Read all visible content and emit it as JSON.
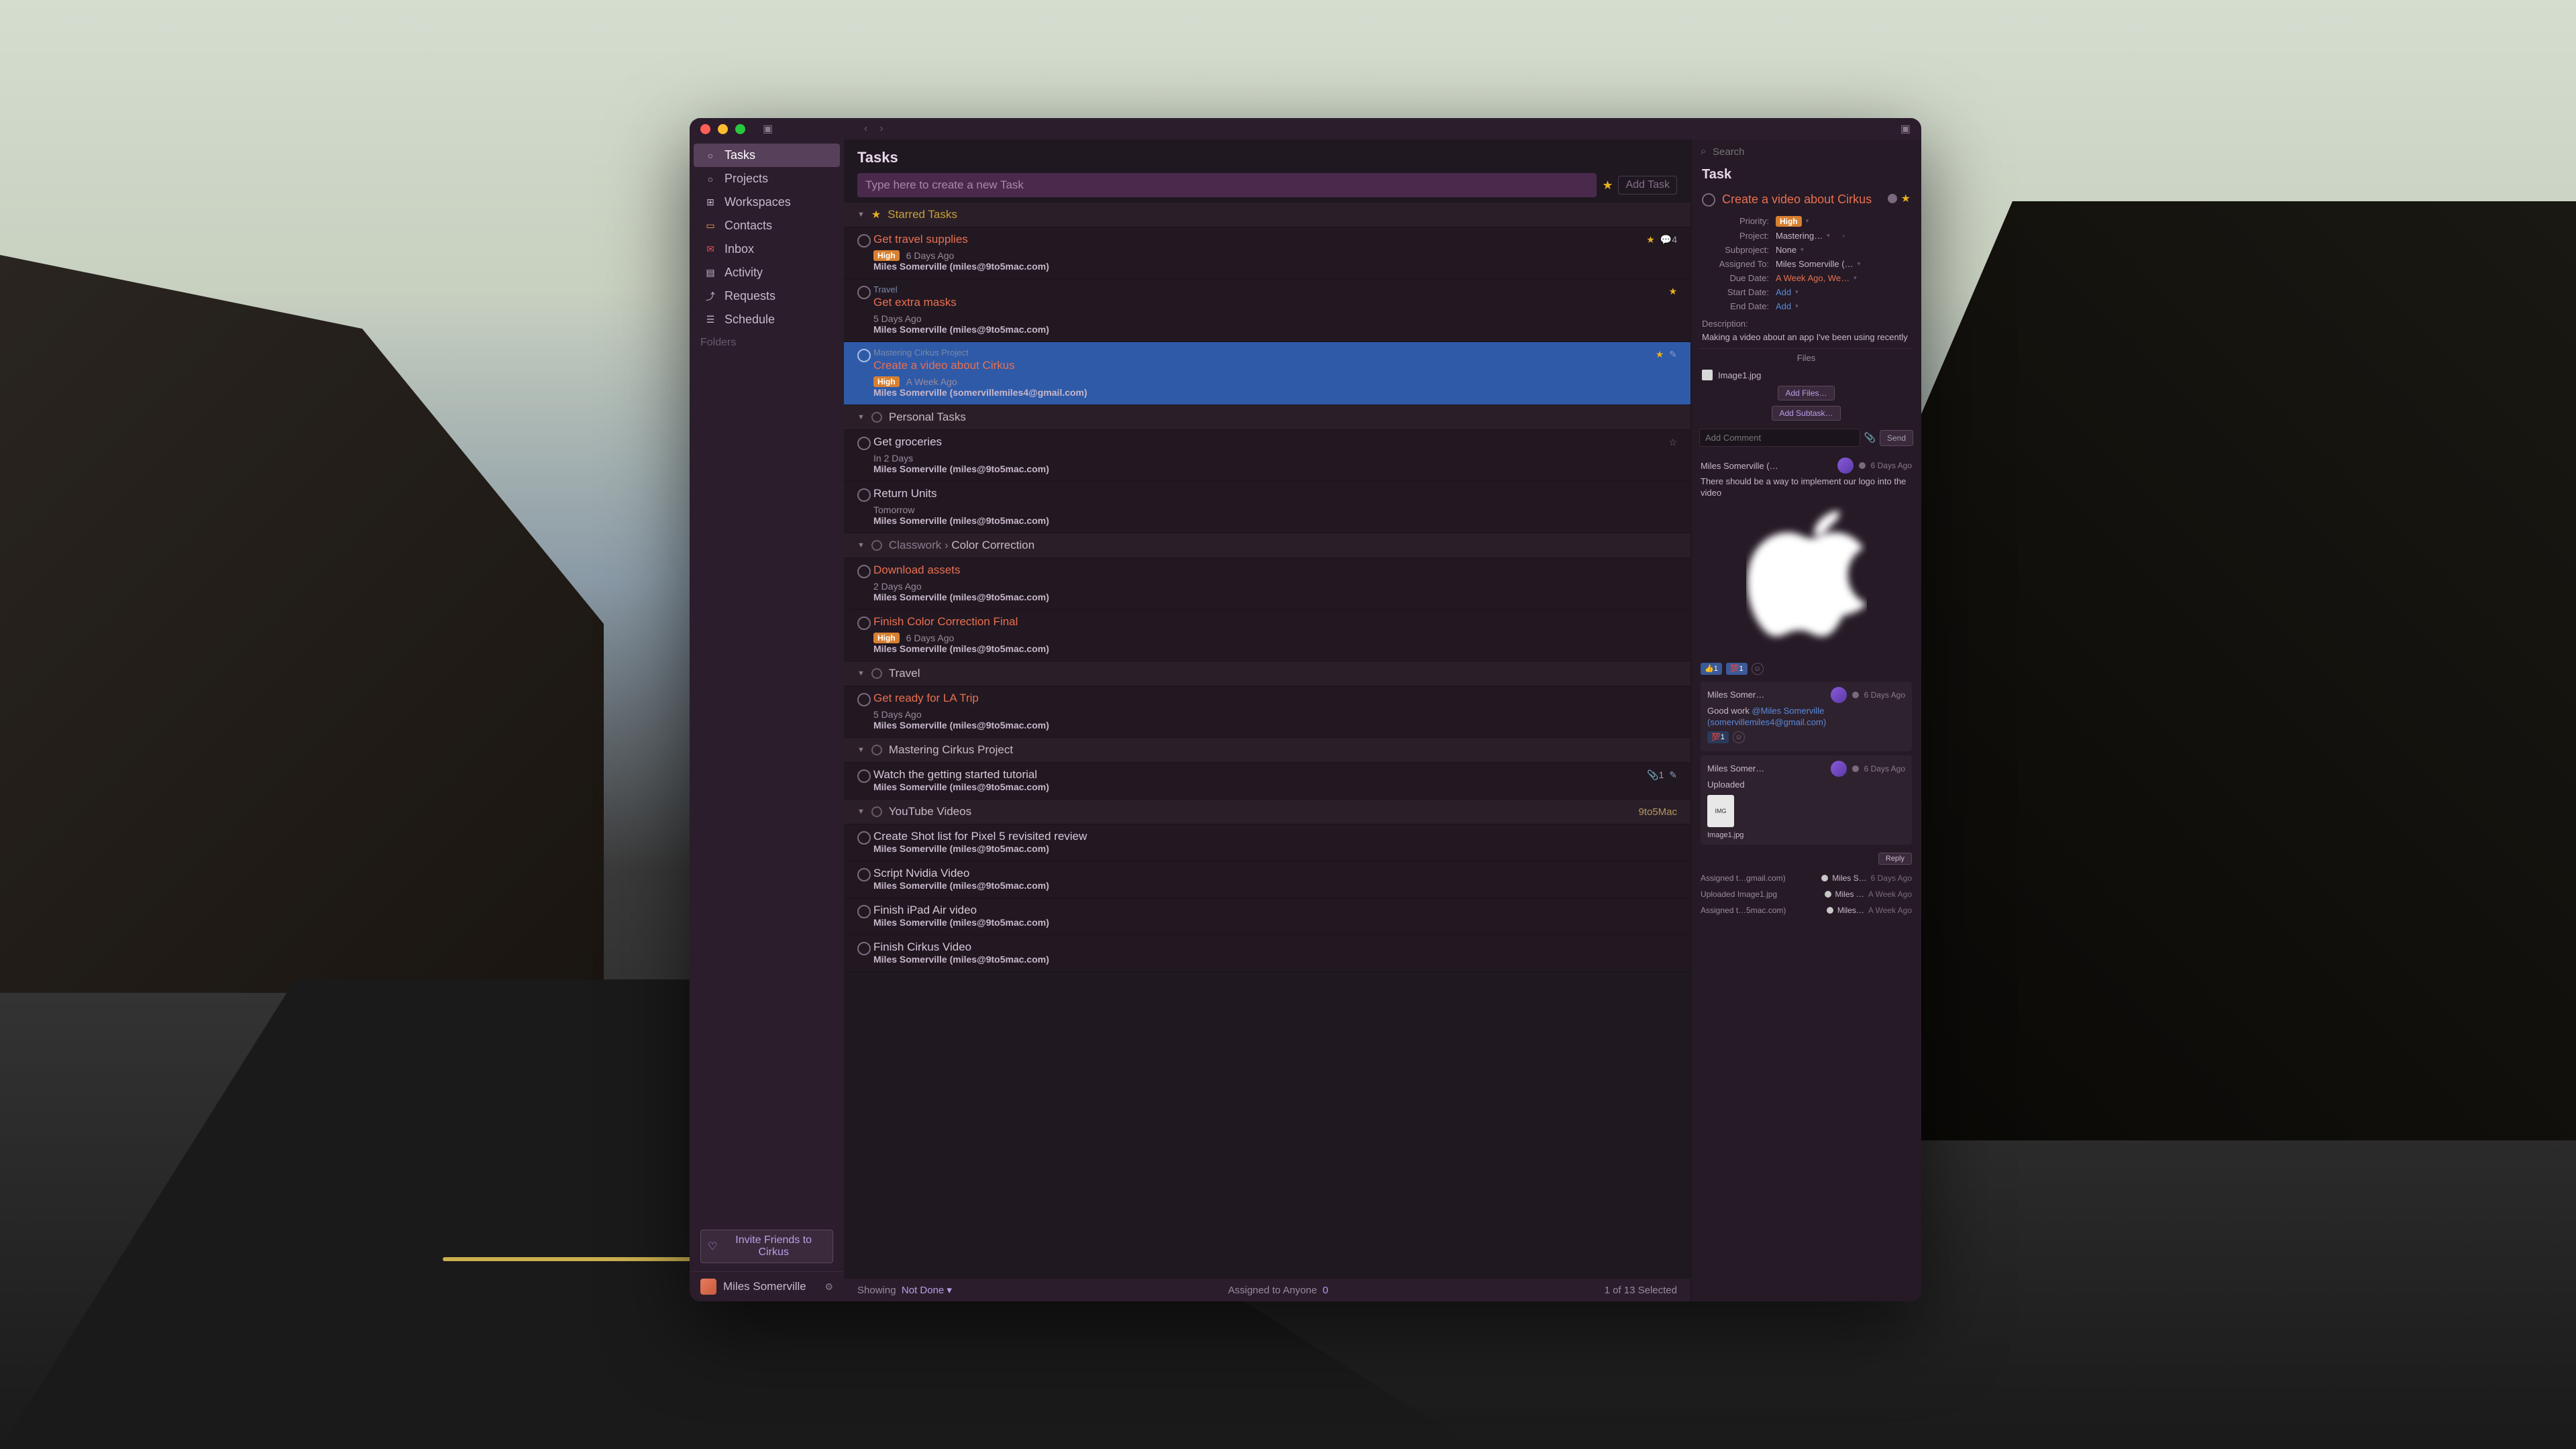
{
  "sidebar": {
    "items": [
      {
        "label": "Tasks",
        "icon": "○"
      },
      {
        "label": "Projects",
        "icon": "○"
      },
      {
        "label": "Workspaces",
        "icon": "⊞"
      },
      {
        "label": "Contacts",
        "icon": "▭"
      },
      {
        "label": "Inbox",
        "icon": "✉"
      },
      {
        "label": "Activity",
        "icon": "▤"
      },
      {
        "label": "Requests",
        "icon": "⤴"
      },
      {
        "label": "Schedule",
        "icon": "☰"
      }
    ],
    "folders_label": "Folders",
    "invite_label": "Invite Friends to Cirkus",
    "user_name": "Miles Somerville"
  },
  "search": {
    "placeholder": "Search"
  },
  "main": {
    "title": "Tasks",
    "new_task_placeholder": "Type here to create a new Task",
    "add_task_label": "Add Task",
    "sections": [
      {
        "id": "starred",
        "title": "Starred Tasks",
        "starred_header": true,
        "tasks": [
          {
            "title": "Get travel supplies",
            "overdue": true,
            "priority": "High",
            "date": "6 Days Ago",
            "assignee": "Miles Somerville (miles@9to5mac.com)",
            "starred": true,
            "comments": 4
          },
          {
            "crumb": "Travel",
            "title": "Get extra masks",
            "overdue": true,
            "date": "5 Days Ago",
            "assignee": "Miles Somerville (miles@9to5mac.com)",
            "starred": true
          },
          {
            "crumb": "Mastering Cirkus Project",
            "title": "Create a video about Cirkus",
            "overdue": true,
            "priority": "High",
            "date": "A Week Ago",
            "assignee": "Miles Somerville (somervillemiles4@gmail.com)",
            "starred": true,
            "selected": true,
            "edit": true
          }
        ]
      },
      {
        "id": "personal",
        "title": "Personal Tasks",
        "circle": true,
        "tasks": [
          {
            "title": "Get groceries",
            "date": "In 2 Days",
            "assignee": "Miles Somerville (miles@9to5mac.com)",
            "starred_outline": true
          },
          {
            "title": "Return Units",
            "date": "Tomorrow",
            "assignee": "Miles Somerville (miles@9to5mac.com)"
          }
        ]
      },
      {
        "id": "color",
        "title_crumb": "Classwork › ",
        "title": "Color Correction",
        "circle": true,
        "tasks": [
          {
            "title": "Download assets",
            "overdue": true,
            "date": "2 Days Ago",
            "assignee": "Miles Somerville (miles@9to5mac.com)"
          },
          {
            "title": "Finish Color Correction Final",
            "overdue": true,
            "priority": "High",
            "date": "6 Days Ago",
            "assignee": "Miles Somerville (miles@9to5mac.com)"
          }
        ]
      },
      {
        "id": "travel",
        "title": "Travel",
        "circle": true,
        "tasks": [
          {
            "title": "Get ready for LA Trip",
            "overdue": true,
            "date": "5 Days Ago",
            "assignee": "Miles Somerville (miles@9to5mac.com)"
          }
        ]
      },
      {
        "id": "mastering",
        "title": "Mastering Cirkus Project",
        "circle": true,
        "tasks": [
          {
            "title": "Watch the getting started tutorial",
            "assignee": "Miles Somerville (miles@9to5mac.com)",
            "attach_count": 1,
            "edit": true
          }
        ]
      },
      {
        "id": "youtube",
        "title": "YouTube Videos",
        "circle": true,
        "badge": "9to5Mac",
        "tasks": [
          {
            "title": "Create Shot list for Pixel 5 revisited review",
            "assignee": "Miles Somerville (miles@9to5mac.com)"
          },
          {
            "title": "Script Nvidia Video",
            "assignee": "Miles Somerville (miles@9to5mac.com)"
          },
          {
            "title": "Finish iPad Air video",
            "assignee": "Miles Somerville (miles@9to5mac.com)"
          },
          {
            "title": "Finish Cirkus Video",
            "assignee": "Miles Somerville (miles@9to5mac.com)"
          }
        ]
      }
    ],
    "footer": {
      "showing_label": "Showing",
      "showing_value": "Not Done",
      "assigned_label": "Assigned to Anyone",
      "assigned_count": "0",
      "selection": "1 of 13 Selected"
    }
  },
  "detail": {
    "header": "Task",
    "title": "Create a video about Cirkus",
    "fields": {
      "priority_label": "Priority:",
      "priority_value": "High",
      "project_label": "Project:",
      "project_value": "Mastering…",
      "subproject_label": "Subproject:",
      "subproject_value": "None",
      "assigned_label": "Assigned To:",
      "assigned_value": "Miles Somerville (…",
      "due_label": "Due Date:",
      "due_value": "A Week Ago, We…",
      "start_label": "Start Date:",
      "start_value": "Add",
      "end_label": "End Date:",
      "end_value": "Add"
    },
    "description_label": "Description:",
    "description": "Making a video about an app I've been using recently",
    "files_header": "Files",
    "file_name": "Image1.jpg",
    "add_files_label": "Add Files…",
    "add_subtask_label": "Add Subtask…",
    "comment_placeholder": "Add Comment",
    "send_label": "Send",
    "comments": [
      {
        "author": "Miles Somerville (…",
        "date": "6 Days Ago",
        "body": "There should be a way to implement our logo into the video",
        "has_logo": true,
        "reactions": [
          {
            "emoji": "👍",
            "count": "1"
          },
          {
            "emoji": "💯",
            "count": "1"
          }
        ],
        "replies": [
          {
            "author": "Miles Somer…",
            "date": "6 Days Ago",
            "body_pre": "Good work ",
            "mention": "@Miles Somerville (somervillemiles4@gmail.com)",
            "reactions": [
              {
                "emoji": "💯",
                "count": "1"
              }
            ]
          },
          {
            "author": "Miles Somer…",
            "date": "6 Days Ago",
            "body": "Uploaded",
            "file": "Image1.jpg"
          }
        ],
        "reply_label": "Reply"
      }
    ],
    "activity_log": [
      {
        "text": "Assigned t…gmail.com)",
        "actor": "Miles S…",
        "date": "6 Days Ago"
      },
      {
        "text": "Uploaded Image1.jpg",
        "actor": "Miles …",
        "date": "A Week Ago"
      },
      {
        "text": "Assigned t…5mac.com)",
        "actor": "Miles…",
        "date": "A Week Ago"
      }
    ]
  }
}
